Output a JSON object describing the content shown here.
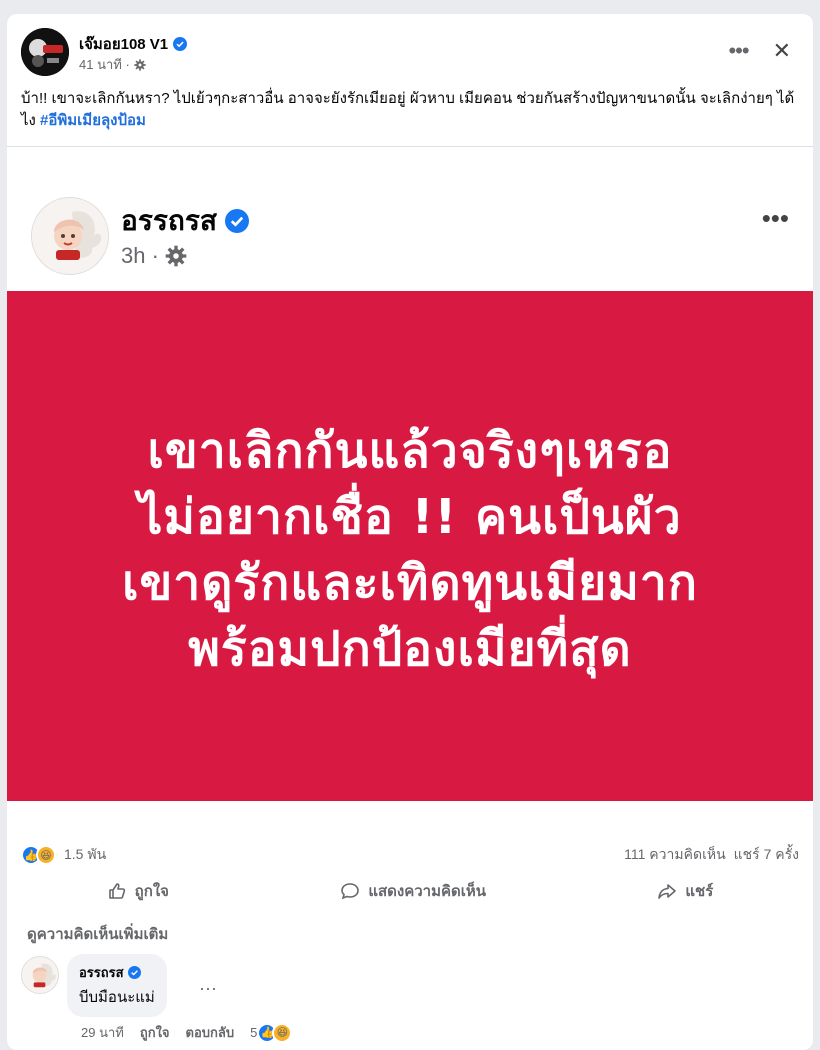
{
  "post": {
    "author": "เจ๊มอย108 V1",
    "time": "41 นาที ·",
    "caption_text": "บ้า!! เขาจะเลิกกันหรา? ไปเย้วๆกะสาวอื่น อาจจะยังรักเมียอยู่ ผัวหาบ เมียคอน ช่วยกันสร้างปัญหาขนาดนั้น จะเลิกง่ายๆ ได้ไง ",
    "hashtag": "#อีพิมเมียลุงป้อม",
    "more_icon": "ellipsis-icon",
    "close_icon": "close-icon",
    "colors": {
      "verified": "#1877f2",
      "hashtag": "#216fdb"
    }
  },
  "shared": {
    "author": "อรรถรส",
    "time": "3h ·",
    "more_icon": "ellipsis-icon",
    "lines": [
      "เขาเลิกกันแล้วจริงๆเหรอ",
      "ไม่อยากเชื่อ !! คนเป็นผัว",
      "เขาดูรักและเทิดทูนเมียมาก",
      "พร้อมปกป้องเมียที่สุด"
    ],
    "colors": {
      "panel": "#d81a43",
      "text": "#ffffff"
    }
  },
  "stats": {
    "reactions": "1.5 พัน",
    "comments": "111 ความคิดเห็น",
    "shares": "แชร์ 7 ครั้ง"
  },
  "actions": {
    "like": "ถูกใจ",
    "comment": "แสดงความคิดเห็น",
    "share": "แชร์"
  },
  "more_comments": "ดูความคิดเห็นเพิ่มเติม",
  "comment": {
    "author": "อรรถรส",
    "text": "บีบมือนะแม่",
    "time": "29 นาที",
    "like": "ถูกใจ",
    "reply": "ตอบกลับ",
    "reactions": "5"
  }
}
